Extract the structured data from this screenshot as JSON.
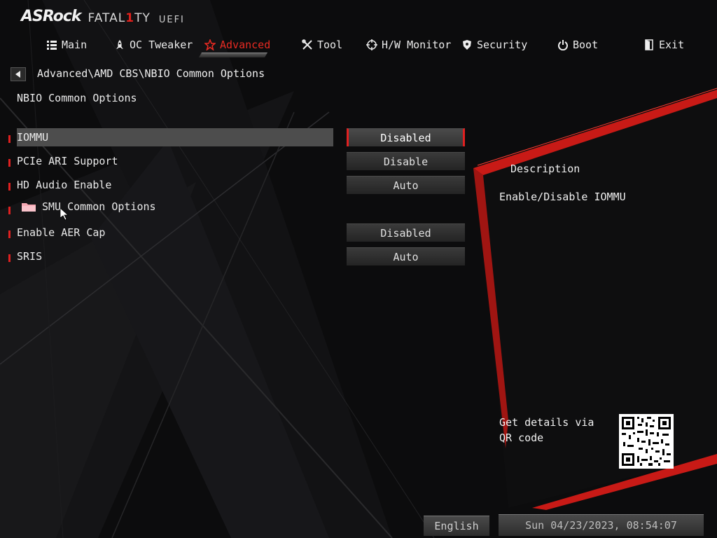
{
  "brand": {
    "name": "ASRock",
    "product_a": "FATAL",
    "product_one": "1",
    "product_b": "TY",
    "uefi": "UEFI"
  },
  "tabs": [
    {
      "label": "Main",
      "icon": "list-icon"
    },
    {
      "label": "OC Tweaker",
      "icon": "rocket-icon"
    },
    {
      "label": "Advanced",
      "icon": "star-icon"
    },
    {
      "label": "Tool",
      "icon": "tools-icon"
    },
    {
      "label": "H/W Monitor",
      "icon": "crosshair-icon"
    },
    {
      "label": "Security",
      "icon": "shield-icon"
    },
    {
      "label": "Boot",
      "icon": "power-icon"
    },
    {
      "label": "Exit",
      "icon": "exit-door-icon"
    }
  ],
  "active_tab": "Advanced",
  "breadcrumb": "Advanced\\AMD CBS\\NBIO Common Options",
  "page_title": "NBIO Common Options",
  "settings": [
    {
      "label": "IOMMU",
      "value": "Disabled"
    },
    {
      "label": "PCIe ARI Support",
      "value": "Disable"
    },
    {
      "label": "HD Audio Enable",
      "value": "Auto"
    },
    {
      "label": "SMU Common Options",
      "value": ""
    },
    {
      "label": "Enable AER Cap",
      "value": "Disabled"
    },
    {
      "label": "SRIS",
      "value": "Auto"
    }
  ],
  "description": {
    "title": "Description",
    "text": "Enable/Disable IOMMU"
  },
  "qr": {
    "text": "Get details via QR code"
  },
  "footer": {
    "language": "English",
    "datetime": "Sun 04/23/2023, 08:54:07"
  },
  "colors": {
    "accent": "#e02020",
    "selected_row": "#4d4d4d",
    "background": "#0b0b0c"
  }
}
